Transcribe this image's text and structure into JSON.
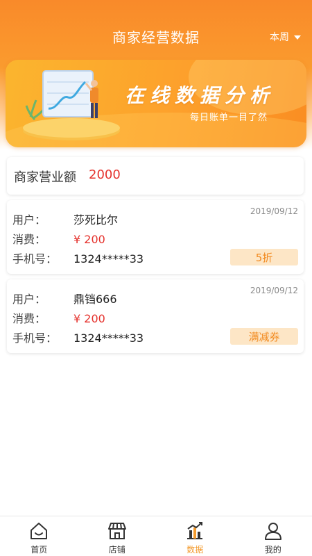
{
  "header": {
    "title": "商家经营数据",
    "period": "本周"
  },
  "banner": {
    "title": "在线数据分析",
    "subtitle": "每日账单一目了然"
  },
  "revenue": {
    "label": "商家营业额",
    "value": "2000"
  },
  "records": [
    {
      "date": "2019/09/12",
      "user_label": "用户：",
      "user": "莎死比尔",
      "spend_label": "消费：",
      "spend": "¥ 200",
      "phone_label": "手机号：",
      "phone": "1324*****33",
      "tag": "5折"
    },
    {
      "date": "2019/09/12",
      "user_label": "用户：",
      "user": "鼎铛666",
      "spend_label": "消费：",
      "spend": "¥ 200",
      "phone_label": "手机号：",
      "phone": "1324*****33",
      "tag": "满减券"
    }
  ],
  "tabbar": {
    "items": [
      {
        "label": "首页",
        "icon": "home-icon"
      },
      {
        "label": "店铺",
        "icon": "store-icon"
      },
      {
        "label": "数据",
        "icon": "chart-icon",
        "active": true
      },
      {
        "label": "我的",
        "icon": "user-icon"
      }
    ]
  },
  "colors": {
    "accent": "#f39a2c",
    "price": "#e5322d",
    "tag_bg": "#fde6c6"
  }
}
